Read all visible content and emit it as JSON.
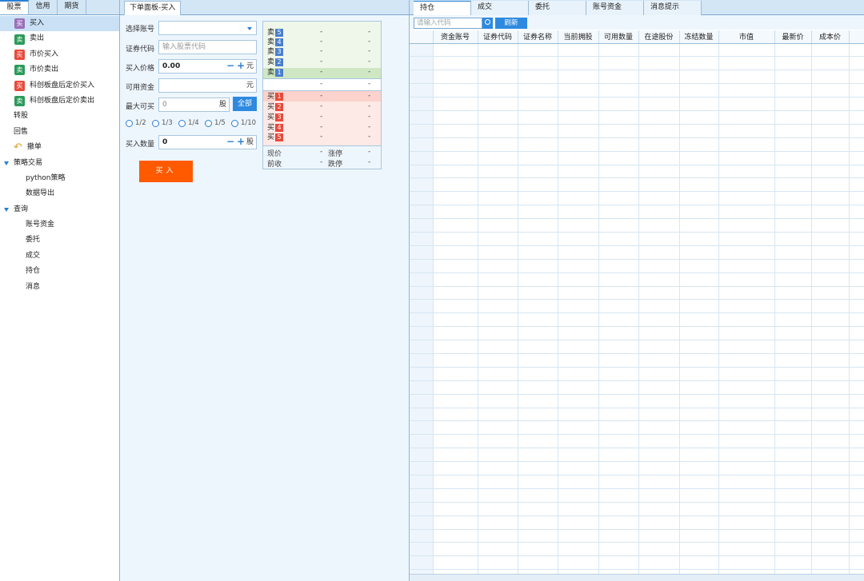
{
  "left_tabs": [
    "股票",
    "信用",
    "期货"
  ],
  "tree": {
    "buy": "买入",
    "sell": "卖出",
    "market_buy": "市价买入",
    "market_sell": "市价卖出",
    "star_after_buy": "科创板盘后定价买入",
    "star_after_sell": "科创板盘后定价卖出",
    "transfer": "转股",
    "resale": "回售",
    "cancel": "撤单",
    "strategy": "策略交易",
    "python": "python策略",
    "export": "数据导出",
    "query": "查询",
    "account_funds": "账号资金",
    "orders": "委托",
    "deals": "成交",
    "positions": "持仓",
    "messages": "消息",
    "badge_buy": "买",
    "badge_sell": "卖"
  },
  "order_panel": {
    "tab": "下单面板-买入",
    "account_label": "选择账号",
    "account_value": "",
    "code_label": "证券代码",
    "code_placeholder": "输入股票代码",
    "price_label": "买入价格",
    "price_value": "0.00",
    "price_unit": "元",
    "funds_label": "可用资金",
    "funds_unit": "元",
    "max_label": "最大可买",
    "max_value": "0",
    "max_unit": "股",
    "all_button": "全部",
    "ratios": [
      "1/2",
      "1/3",
      "1/4",
      "1/5",
      "1/10"
    ],
    "qty_label": "买入数量",
    "qty_value": "0",
    "qty_unit": "股",
    "submit": "买入",
    "minus": "−",
    "plus": "+"
  },
  "order_book": {
    "sell_levels": [
      {
        "label": "卖",
        "num": "5",
        "price": "-",
        "vol": "-"
      },
      {
        "label": "卖",
        "num": "4",
        "price": "-",
        "vol": "-"
      },
      {
        "label": "卖",
        "num": "3",
        "price": "-",
        "vol": "-"
      },
      {
        "label": "卖",
        "num": "2",
        "price": "-",
        "vol": "-"
      },
      {
        "label": "卖",
        "num": "1",
        "price": "-",
        "vol": "-"
      }
    ],
    "mid": {
      "price": "-",
      "vol": "-"
    },
    "buy_levels": [
      {
        "label": "买",
        "num": "1",
        "price": "-",
        "vol": "-"
      },
      {
        "label": "买",
        "num": "2",
        "price": "-",
        "vol": "-"
      },
      {
        "label": "买",
        "num": "3",
        "price": "-",
        "vol": "-"
      },
      {
        "label": "买",
        "num": "4",
        "price": "-",
        "vol": "-"
      },
      {
        "label": "买",
        "num": "5",
        "price": "-",
        "vol": "-"
      }
    ],
    "current_label": "现价",
    "current_value": "-",
    "limit_up_label": "涨停",
    "limit_up_value": "-",
    "prev_close_label": "前收",
    "prev_close_value": "-",
    "limit_down_label": "跌停",
    "limit_down_value": "-"
  },
  "right_tabs": [
    "持仓",
    "成交",
    "委托",
    "账号资金",
    "消息提示"
  ],
  "search": {
    "placeholder": "请输入代码",
    "refresh": "刷新"
  },
  "grid_columns": [
    "资金账号",
    "证券代码",
    "证券名称",
    "当前拥股",
    "可用数量",
    "在途股份",
    "冻结数量",
    "市值",
    "最新价",
    "成本价"
  ],
  "colors": {
    "accent": "#2e8ae0",
    "buy_button": "#ff5a00",
    "buy_badge": "#e84a3b",
    "sell_badge": "#2b9a5a"
  }
}
